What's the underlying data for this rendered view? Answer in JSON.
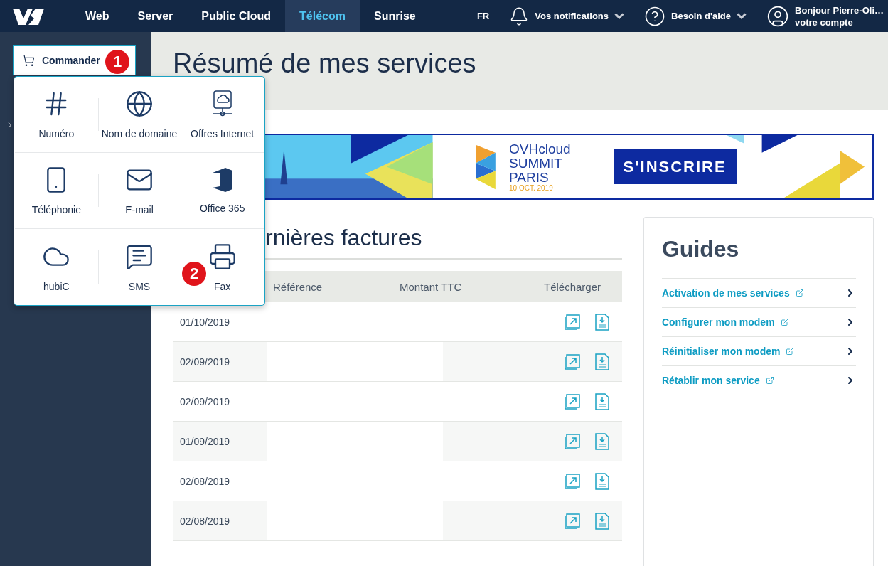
{
  "nav": {
    "items": [
      {
        "label": "Web",
        "selected": false
      },
      {
        "label": "Server",
        "selected": false
      },
      {
        "label": "Public Cloud",
        "selected": false
      },
      {
        "label": "Télécom",
        "selected": true
      },
      {
        "label": "Sunrise",
        "selected": false
      }
    ],
    "language": "FR",
    "notifications": "Vos notifications",
    "help": "Besoin d'aide",
    "greeting": "Bonjour Pierre-Oli…",
    "account": "votre compte"
  },
  "sidebar": {
    "order_button": "Commander"
  },
  "order_menu": {
    "items": [
      {
        "label": "Numéro"
      },
      {
        "label": "Nom de domaine"
      },
      {
        "label": "Offres Internet"
      },
      {
        "label": "Téléphonie"
      },
      {
        "label": "E-mail"
      },
      {
        "label": "Office 365"
      },
      {
        "label": "hubiC"
      },
      {
        "label": "SMS"
      },
      {
        "label": "Fax"
      }
    ]
  },
  "annotations": [
    {
      "label": "1"
    },
    {
      "label": "2"
    }
  ],
  "page_title": "Résumé de mes services",
  "banner": {
    "brand": "OVHcloud",
    "event": "SUMMIT",
    "city": "PARIS",
    "date": "10 OCT. 2019",
    "button": "S'INSCRIRE"
  },
  "invoices": {
    "title": "rnières factures",
    "columns": [
      "Référence",
      "Montant TTC",
      "Télécharger"
    ],
    "rows": [
      {
        "date": "01/10/2019"
      },
      {
        "date": "02/09/2019"
      },
      {
        "date": "02/09/2019"
      },
      {
        "date": "01/09/2019"
      },
      {
        "date": "02/08/2019"
      },
      {
        "date": "02/08/2019"
      }
    ]
  },
  "guides": {
    "title": "Guides",
    "links": [
      {
        "label": "Activation de mes services"
      },
      {
        "label": "Configurer mon modem"
      },
      {
        "label": "Réinitialiser mon modem"
      },
      {
        "label": "Rétablir mon service"
      }
    ]
  }
}
